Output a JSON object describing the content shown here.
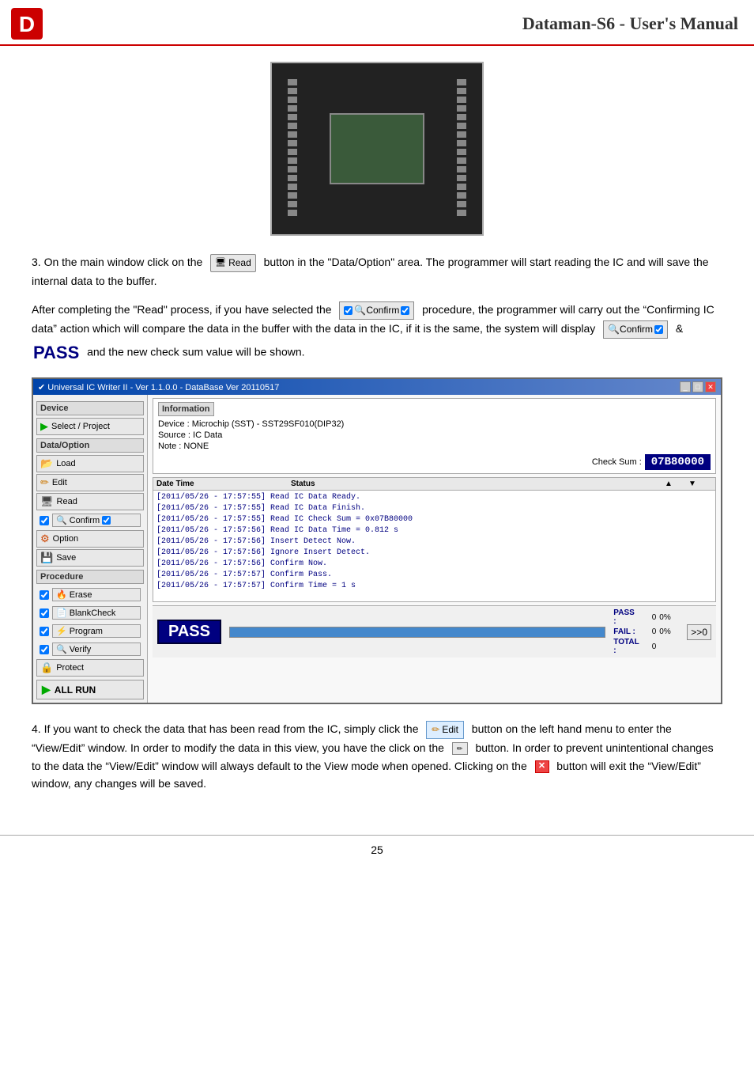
{
  "header": {
    "title": "Dataman-S6 - User's Manual"
  },
  "step3": {
    "text1": "3.  On the main window click on the",
    "read_button_label": "Read",
    "text2": "button in the \"Data/Option\" area. The programmer will start reading the IC and will save the internal data to the buffer.",
    "text3": "After completing the \"Read\" process, if you have selected the",
    "confirm_check_label": "Confirm",
    "text4": "procedure, the programmer will carry out the “Confirming IC data” action which will compare the data in the buffer with the data in the IC, if it is the same, the system will display",
    "confirm_badge_label": "Confirm",
    "text5": "&",
    "pass_text": "PASS",
    "text6": "and the new check sum value will be shown."
  },
  "app_window": {
    "title": "✔ Universal IC Writer II - Ver 1.1.0.0 - DataBase Ver 20110517",
    "titlebar_btns": [
      "_",
      "□",
      "X"
    ],
    "device_section": "Device",
    "select_project_label": "Select / Project",
    "data_option_section": "Data/Option",
    "load_label": "Load",
    "edit_label": "Edit",
    "read_label": "Read",
    "confirm_label": "Confirm",
    "option_label": "Option",
    "save_label": "Save",
    "procedure_section": "Procedure",
    "erase_label": "Erase",
    "blankcheck_label": "BlankCheck",
    "program_label": "Program",
    "verify_label": "Verify",
    "protect_label": "Protect",
    "all_run_label": "ALL RUN",
    "info_section": "Information",
    "device_info": "Device : Microchip (SST) - SST29SF010(DIP32)",
    "source_info": "Source : IC Data",
    "note_label": "Note",
    "note_value": "NONE",
    "check_sum_label": "Check Sum :",
    "check_sum_value": "07B80000",
    "log_col1": "Date Time",
    "log_col2": "Status",
    "log_entries": [
      "[2011/05/26 - 17:57:55] Read IC Data Ready.",
      "[2011/05/26 - 17:57:55] Read IC Data Finish.",
      "[2011/05/26 - 17:57:55] Read IC Check Sum = 0x07B80000",
      "[2011/05/26 - 17:57:56] Read IC Data Time = 0.812 s",
      "[2011/05/26 - 17:57:56] Insert Detect Now.",
      "[2011/05/26 - 17:57:56] Ignore Insert Detect.",
      "[2011/05/26 - 17:57:56] Confirm Now.",
      "[2011/05/26 - 17:57:57] Confirm Pass.",
      "[2011/05/26 - 17:57:57] Confirm Time = 1 s"
    ],
    "pass_display": "PASS",
    "pass_label": "PASS :",
    "pass_value": "0",
    "pass_pct": "0%",
    "fail_label": "FAIL :",
    "fail_value": "0",
    "fail_pct": "0%",
    "total_label": "TOTAL :",
    "total_value": "0"
  },
  "step4": {
    "text1": "4.  If you want to check the data that has been read from the IC, simply click the",
    "edit_btn_label": "Edit",
    "text2": "button on the left hand menu to enter the “View/Edit” window. In order to modify the data in this view, you have the click on the",
    "text3": "button. In order to prevent unintentional changes to the data the “View/Edit” window will always default to the View mode when opened. Clicking on the",
    "text4": "button will exit the “View/Edit” window, any changes will be saved."
  },
  "page_number": "25"
}
